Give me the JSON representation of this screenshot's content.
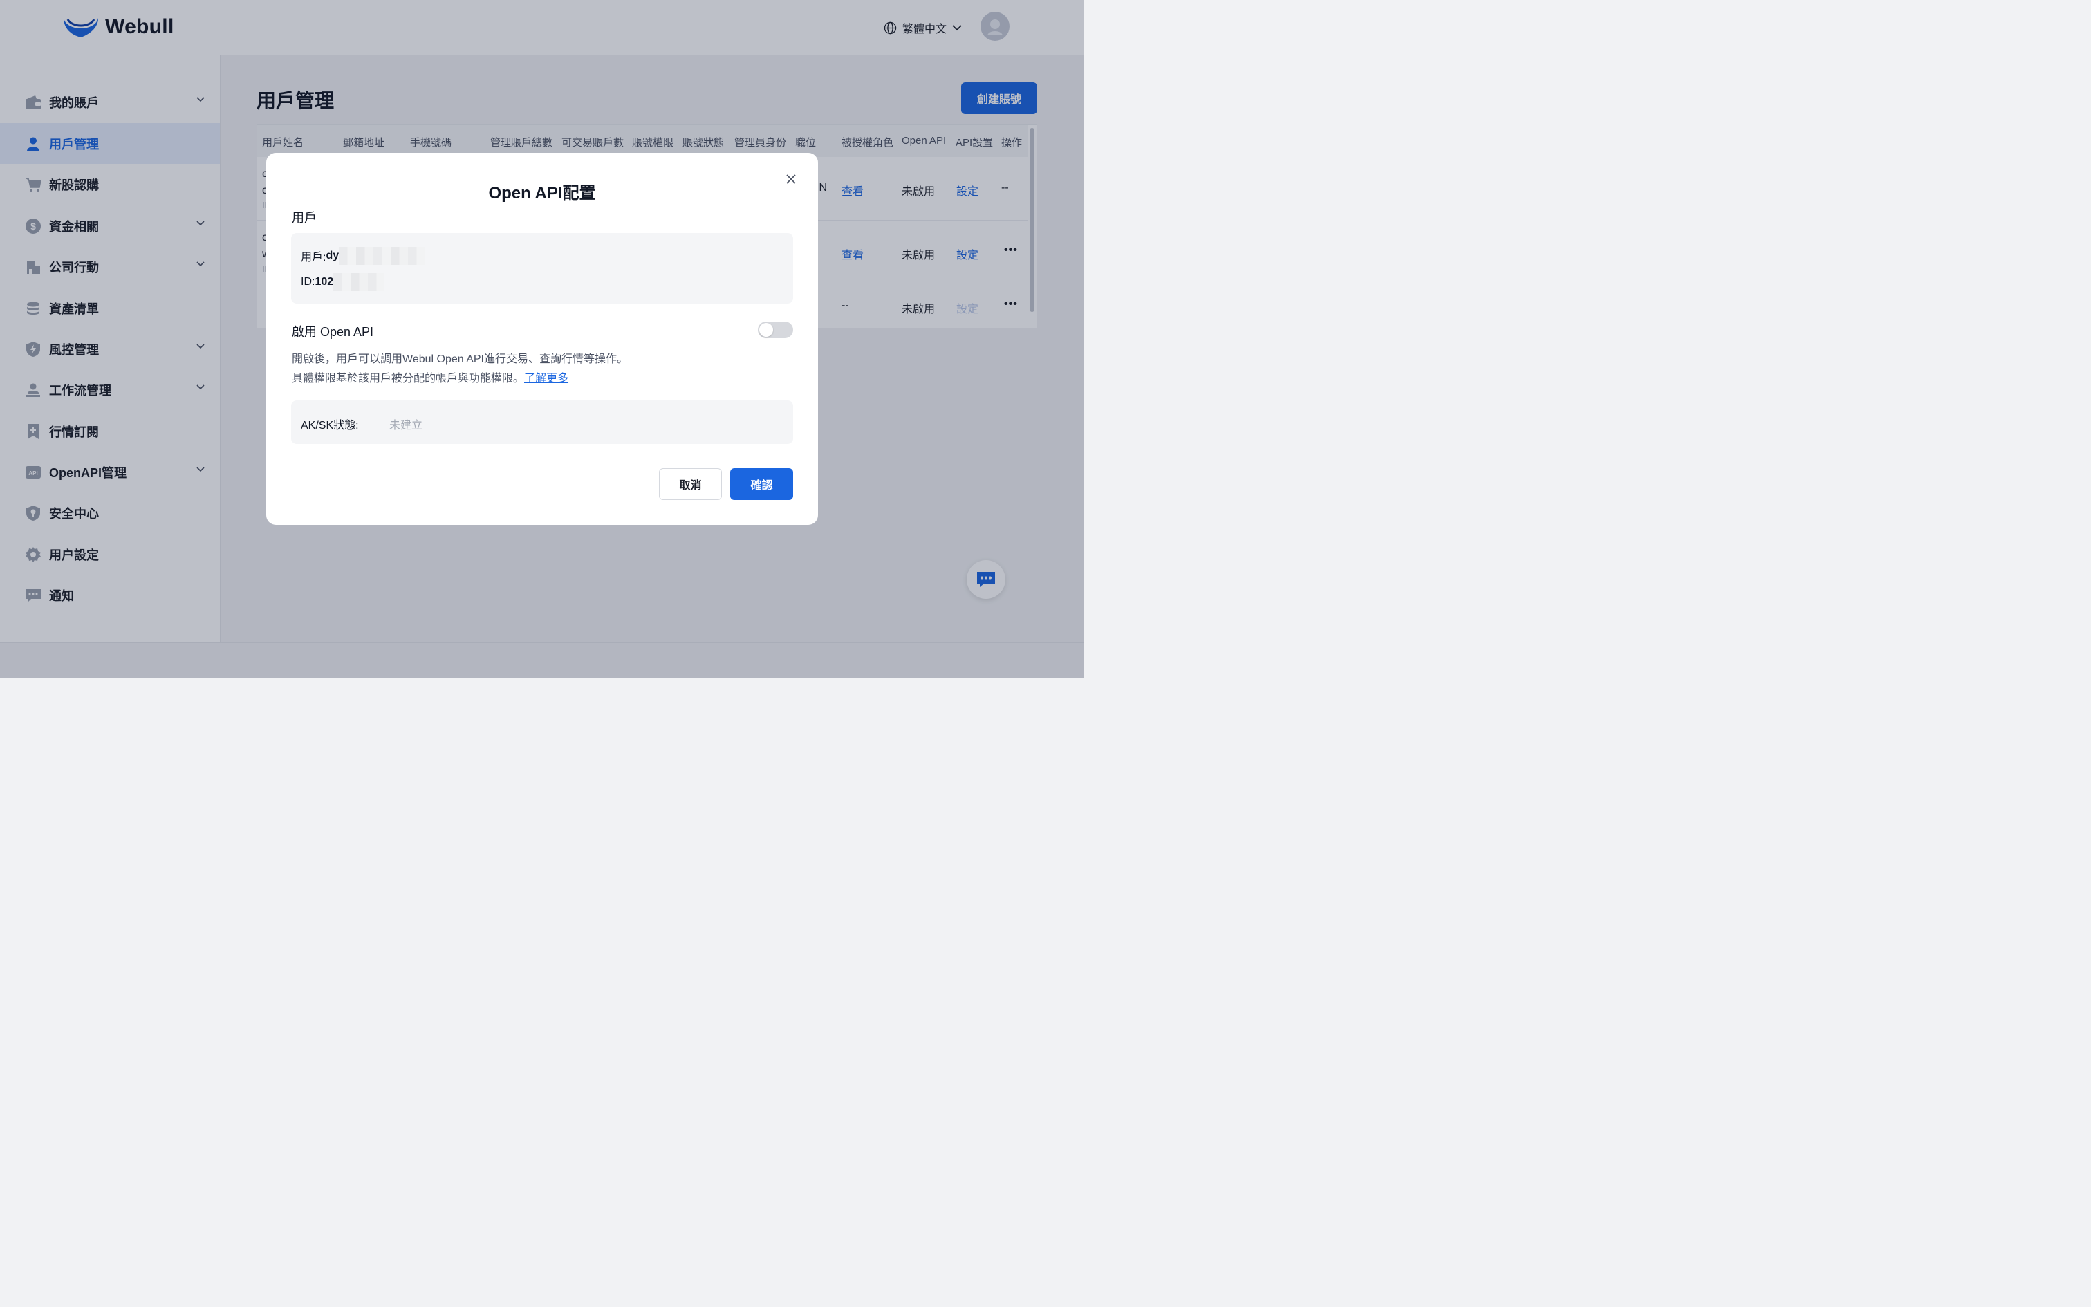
{
  "header": {
    "brand": "Webull",
    "language": "繁體中文"
  },
  "sidebar": {
    "items": [
      {
        "label": "我的賬戶",
        "icon": "wallet-icon",
        "expandable": true,
        "active": false
      },
      {
        "label": "用戶管理",
        "icon": "user-icon",
        "expandable": false,
        "active": true
      },
      {
        "label": "新股認購",
        "icon": "cart-icon",
        "expandable": false,
        "active": false
      },
      {
        "label": "資金相關",
        "icon": "dollar-coin-icon",
        "expandable": true,
        "active": false
      },
      {
        "label": "公司行動",
        "icon": "building-icon",
        "expandable": true,
        "active": false
      },
      {
        "label": "資產清單",
        "icon": "coins-stack-icon",
        "expandable": false,
        "active": false
      },
      {
        "label": "風控管理",
        "icon": "shield-bolt-icon",
        "expandable": true,
        "active": false
      },
      {
        "label": "工作流管理",
        "icon": "workflow-icon",
        "expandable": true,
        "active": false
      },
      {
        "label": "行情訂閱",
        "icon": "bookmark-plus-icon",
        "expandable": false,
        "active": false
      },
      {
        "label": "OpenAPI管理",
        "icon": "api-icon",
        "expandable": true,
        "active": false
      },
      {
        "label": "安全中心",
        "icon": "shield-pin-icon",
        "expandable": false,
        "active": false
      },
      {
        "label": "用户設定",
        "icon": "gear-icon",
        "expandable": false,
        "active": false
      },
      {
        "label": "通知",
        "icon": "message-icon",
        "expandable": false,
        "active": false
      }
    ]
  },
  "main": {
    "title": "用戶管理",
    "create_button": "創建賬號",
    "table": {
      "headers": [
        "用戶姓名",
        "郵箱地址",
        "手機號碼",
        "管理賬戶總數",
        "可交易賬戶數",
        "賬號權限",
        "賬號狀態",
        "管理員身份",
        "職位",
        "被授權角色",
        "Open API",
        "API設置",
        "操作"
      ],
      "rows": [
        {
          "name_line1": "c",
          "name_line2": "c",
          "name_line3": "ID",
          "tail": "IN",
          "role": "查看",
          "open_api": "未啟用",
          "api_setting": "設定",
          "action": "--"
        },
        {
          "name_line1": "c",
          "name_line2": "w",
          "name_line3": "ID",
          "tail": "",
          "role": "查看",
          "open_api": "未啟用",
          "api_setting": "設定",
          "action": "•••"
        },
        {
          "name_line1": "",
          "name_line2": "",
          "name_line3": "",
          "tail": "",
          "role": "--",
          "open_api": "未啟用",
          "api_setting": "設定",
          "action": "•••"
        }
      ]
    }
  },
  "modal": {
    "title": "Open API配置",
    "section_label": "用戶",
    "user_prefix": "用戶:",
    "user_value_visible": "dy",
    "id_prefix": "ID: ",
    "id_value_visible": "102",
    "enable_label": "啟用 Open API",
    "toggle_on": false,
    "desc_line1": "開啟後，用戶可以調用Webul Open API進行交易、查詢行情等操作。",
    "desc_line2": "具體權限基於該用戶被分配的帳戶與功能權限。",
    "learn_more": "了解更多",
    "ak_label": "AK/SK狀態:",
    "ak_value": "未建立",
    "cancel": "取消",
    "confirm": "確認"
  },
  "colors": {
    "accent": "#1b66e0",
    "overlay": "#121c38"
  }
}
